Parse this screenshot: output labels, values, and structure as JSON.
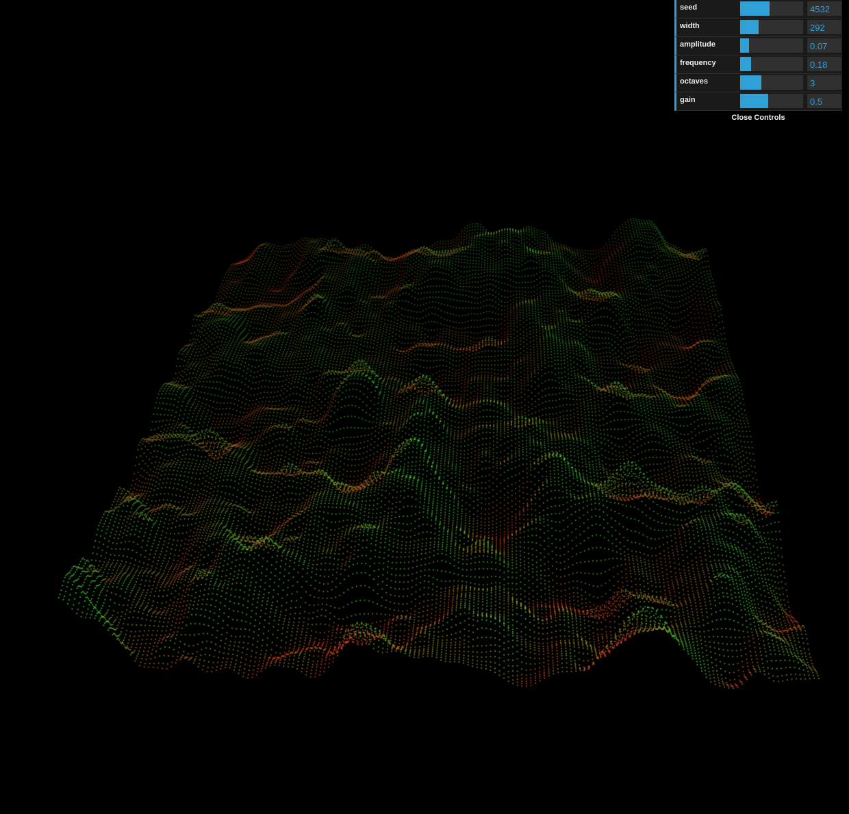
{
  "scene": {
    "background": "#000000",
    "point_color_high": "#3ce03a",
    "point_color_low": "#e03a1e"
  },
  "controls": {
    "accent_color": "#2fa1d6",
    "rows": [
      {
        "key": "seed",
        "label": "seed",
        "value": "4532",
        "fill": 0.47
      },
      {
        "key": "width",
        "label": "width",
        "value": "292",
        "fill": 0.29
      },
      {
        "key": "amplitude",
        "label": "amplitude",
        "value": "0.07",
        "fill": 0.14
      },
      {
        "key": "frequency",
        "label": "frequency",
        "value": "0.18",
        "fill": 0.17
      },
      {
        "key": "octaves",
        "label": "octaves",
        "value": "3",
        "fill": 0.34
      },
      {
        "key": "gain",
        "label": "gain",
        "value": "0.5",
        "fill": 0.45
      }
    ],
    "close_label": "Close Controls"
  }
}
